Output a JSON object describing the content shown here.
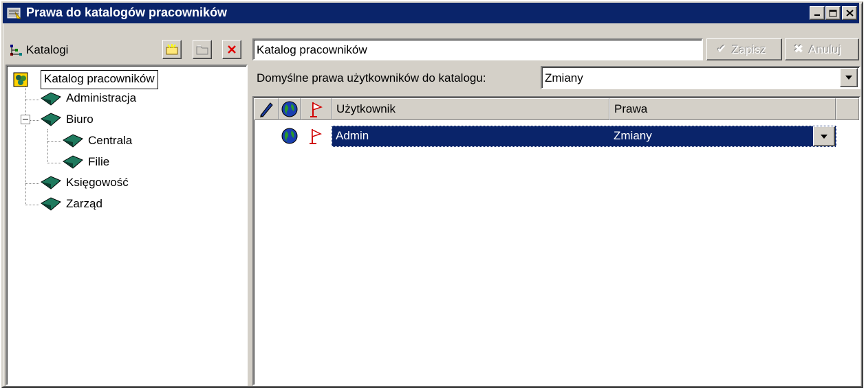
{
  "window": {
    "title": "Prawa do katalogów pracowników",
    "title_icon": "catalog-rights-icon",
    "controls": [
      "minimize",
      "maximize",
      "close"
    ]
  },
  "sidebar": {
    "header_label": "Katalogi",
    "header_icon": "tree-icon",
    "toolbar": [
      {
        "name": "new-catalog",
        "icon": "new-folder-icon"
      },
      {
        "name": "catalog-properties",
        "icon": "folder-icon"
      },
      {
        "name": "delete-catalog",
        "icon": "red-x-icon"
      }
    ],
    "tree": {
      "root": "Katalog pracowników",
      "items": [
        {
          "label": "Administracja",
          "level": 1
        },
        {
          "label": "Biuro",
          "level": 1,
          "expanded": true
        },
        {
          "label": "Centrala",
          "level": 2
        },
        {
          "label": "Filie",
          "level": 2
        },
        {
          "label": "Księgowość",
          "level": 1
        },
        {
          "label": "Zarząd",
          "level": 1
        }
      ]
    }
  },
  "main": {
    "catalog_name_value": "Katalog pracowników",
    "save_label": "Zapisz",
    "cancel_label": "Anuluj",
    "default_rights_label": "Domyślne prawa użytkowników do katalogu:",
    "default_rights_value": "Zmiany",
    "table": {
      "columns": [
        "Użytkownik",
        "Prawa"
      ],
      "header_icons": [
        "pencil-icon",
        "globe-icon",
        "red-flag-icon"
      ],
      "rows": [
        {
          "user": "Admin",
          "rights": "Zmiany",
          "selected": true
        }
      ]
    }
  },
  "colors": {
    "title_bar": "#0a246a",
    "face": "#d4d0c8",
    "selection": "#0a246a",
    "book": "#1f7a5e"
  }
}
